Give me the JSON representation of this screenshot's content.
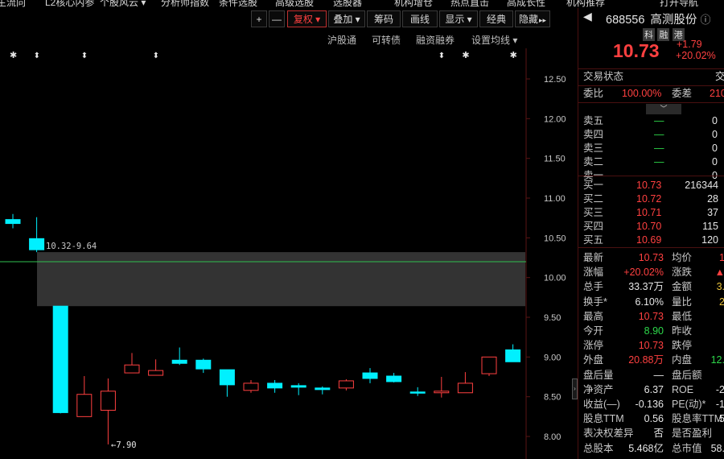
{
  "top_menu": [
    "主流向",
    "L2核心内参",
    "个股风云 ▾",
    "分析师指数",
    "条件选股",
    "高级选股",
    "选股器",
    "机构增仓",
    "热点直击",
    "高成长性",
    "机构推荐",
    "打开导航"
  ],
  "toolbar": {
    "plus": "+",
    "minus": "—",
    "buttons": [
      "复权 ▾",
      "叠加 ▾",
      "筹码",
      "画线",
      "显示 ▾",
      "经典",
      "隐藏"
    ],
    "hide_arrow": "▸▸"
  },
  "subbar": [
    "沪股通",
    "可转债",
    "融资融券",
    "设置均线 ▾"
  ],
  "chart": {
    "y_ticks": [
      "12.50",
      "12.00",
      "11.50",
      "11.00",
      "10.50",
      "10.00",
      "9.50",
      "9.00",
      "8.50",
      "8.00"
    ],
    "gap_label": "10.32-9.64",
    "low_label": "←7.90",
    "marker_star": "✱",
    "marker_arrow": "⬍",
    "colors": {
      "up": "#ff4040",
      "down": "#00f0ff",
      "ref_line": "#2fbf4f",
      "band": "#3c3c3c"
    }
  },
  "chart_data": {
    "type": "candlestick",
    "ylim": [
      7.85,
      12.75
    ],
    "gap_band": [
      9.64,
      10.32
    ],
    "reference_line": 10.2,
    "y_ticks": [
      12.5,
      12.0,
      11.5,
      11.0,
      10.5,
      10.0,
      9.5,
      9.0,
      8.5,
      8.0
    ],
    "candles": [
      {
        "o": 10.73,
        "c": 10.68,
        "h": 10.8,
        "l": 10.62
      },
      {
        "o": 10.49,
        "c": 10.35,
        "h": 10.76,
        "l": 10.32
      },
      {
        "o": 9.64,
        "c": 8.3,
        "h": 9.64,
        "l": 8.29
      },
      {
        "o": 8.25,
        "c": 8.53,
        "h": 8.76,
        "l": 8.25
      },
      {
        "o": 8.33,
        "c": 8.57,
        "h": 8.73,
        "l": 7.9
      },
      {
        "o": 8.8,
        "c": 8.9,
        "h": 9.05,
        "l": 8.8
      },
      {
        "o": 8.77,
        "c": 8.83,
        "h": 8.97,
        "l": 8.77
      },
      {
        "o": 8.96,
        "c": 8.92,
        "h": 9.12,
        "l": 8.9
      },
      {
        "o": 8.96,
        "c": 8.85,
        "h": 8.98,
        "l": 8.8
      },
      {
        "o": 8.84,
        "c": 8.65,
        "h": 8.84,
        "l": 8.5
      },
      {
        "o": 8.58,
        "c": 8.67,
        "h": 8.71,
        "l": 8.55
      },
      {
        "o": 8.67,
        "c": 8.61,
        "h": 8.71,
        "l": 8.55
      },
      {
        "o": 8.64,
        "c": 8.62,
        "h": 8.67,
        "l": 8.52
      },
      {
        "o": 8.61,
        "c": 8.59,
        "h": 8.63,
        "l": 8.53
      },
      {
        "o": 8.61,
        "c": 8.7,
        "h": 8.72,
        "l": 8.58
      },
      {
        "o": 8.8,
        "c": 8.73,
        "h": 8.86,
        "l": 8.67
      },
      {
        "o": 8.76,
        "c": 8.69,
        "h": 8.8,
        "l": 8.68
      },
      {
        "o": 8.56,
        "c": 8.55,
        "h": 8.62,
        "l": 8.51
      },
      {
        "o": 8.55,
        "c": 8.57,
        "h": 8.75,
        "l": 8.49
      },
      {
        "o": 8.55,
        "c": 8.67,
        "h": 8.81,
        "l": 8.55
      },
      {
        "o": 8.79,
        "c": 9.0,
        "h": 9.0,
        "l": 8.76
      },
      {
        "o": 9.09,
        "c": 8.94,
        "h": 9.16,
        "l": 8.94
      }
    ],
    "markers": [
      {
        "index": 0,
        "kind": "star"
      },
      {
        "index": 1,
        "kind": "arrow"
      },
      {
        "index": 3,
        "kind": "arrow"
      },
      {
        "index": 6,
        "kind": "arrow"
      },
      {
        "index": 18,
        "kind": "arrow"
      },
      {
        "index": 19,
        "kind": "star"
      },
      {
        "index": 21,
        "kind": "star"
      }
    ]
  },
  "quote": {
    "code": "688556",
    "name": "高测股份",
    "info_icon": "ⓘ",
    "tags": [
      "科",
      "融",
      "港"
    ],
    "price": "10.73",
    "change": "+1.79",
    "change_pct": "+20.02%",
    "status_label": "交易状态",
    "status_value": "交",
    "ratio_label": "委比",
    "ratio_value": "100.00%",
    "diff_label": "委差",
    "diff_value": "210",
    "asks": [
      {
        "label": "卖五",
        "price": "—",
        "vol": "0"
      },
      {
        "label": "卖四",
        "price": "—",
        "vol": "0"
      },
      {
        "label": "卖三",
        "price": "—",
        "vol": "0"
      },
      {
        "label": "卖二",
        "price": "—",
        "vol": "0"
      },
      {
        "label": "卖一",
        "price": "—",
        "vol": "0"
      }
    ],
    "bids": [
      {
        "label": "买一",
        "price": "10.73",
        "vol": "216344"
      },
      {
        "label": "买二",
        "price": "10.72",
        "vol": "28"
      },
      {
        "label": "买三",
        "price": "10.71",
        "vol": "37"
      },
      {
        "label": "买四",
        "price": "10.70",
        "vol": "115"
      },
      {
        "label": "买五",
        "price": "10.69",
        "vol": "120"
      }
    ],
    "stats": [
      {
        "l1": "最新",
        "v1": "10.73",
        "c1": "red",
        "l2": "均价",
        "v2": "1",
        "c2": "red"
      },
      {
        "l1": "涨幅",
        "v1": "+20.02%",
        "c1": "red",
        "l2": "涨跌",
        "v2": "▲",
        "c2": "red"
      },
      {
        "l1": "总手",
        "v1": "33.37万",
        "c1": "white",
        "l2": "金额",
        "v2": "3.",
        "c2": "yel"
      },
      {
        "l1": "换手*",
        "v1": "6.10%",
        "c1": "white",
        "l2": "量比",
        "v2": "2",
        "c2": "yel"
      },
      {
        "l1": "最高",
        "v1": "10.73",
        "c1": "red",
        "l2": "最低",
        "v2": "",
        "c2": "green"
      },
      {
        "l1": "今开",
        "v1": "8.90",
        "c1": "green",
        "l2": "昨收",
        "v2": "",
        "c2": "white"
      },
      {
        "l1": "涨停",
        "v1": "10.73",
        "c1": "red",
        "l2": "跌停",
        "v2": "",
        "c2": "green"
      },
      {
        "l1": "外盘",
        "v1": "20.88万",
        "c1": "red",
        "l2": "内盘",
        "v2": "12.",
        "c2": "green"
      },
      {
        "l1": "盘后量",
        "v1": "—",
        "c1": "white",
        "l2": "盘后额",
        "v2": "",
        "c2": "white"
      },
      {
        "l1": "净资产",
        "v1": "6.37",
        "c1": "white",
        "l2": "ROE",
        "v2": "-2",
        "c2": "white"
      },
      {
        "l1": "收益(—)",
        "v1": "-0.136",
        "c1": "white",
        "l2": "PE(动)*",
        "v2": "-1",
        "c2": "white"
      },
      {
        "l1": "股息TTM",
        "v1": "0.56",
        "c1": "white",
        "l2": "股息率TTM",
        "v2": "5",
        "c2": "white"
      },
      {
        "l1": "表决权差异",
        "v1": "否",
        "c1": "white",
        "l2": "是否盈利",
        "v2": "",
        "c2": "white"
      },
      {
        "l1": "总股本",
        "v1": "5.468亿",
        "c1": "white",
        "l2": "总市值",
        "v2": "58.",
        "c2": "white"
      }
    ]
  }
}
